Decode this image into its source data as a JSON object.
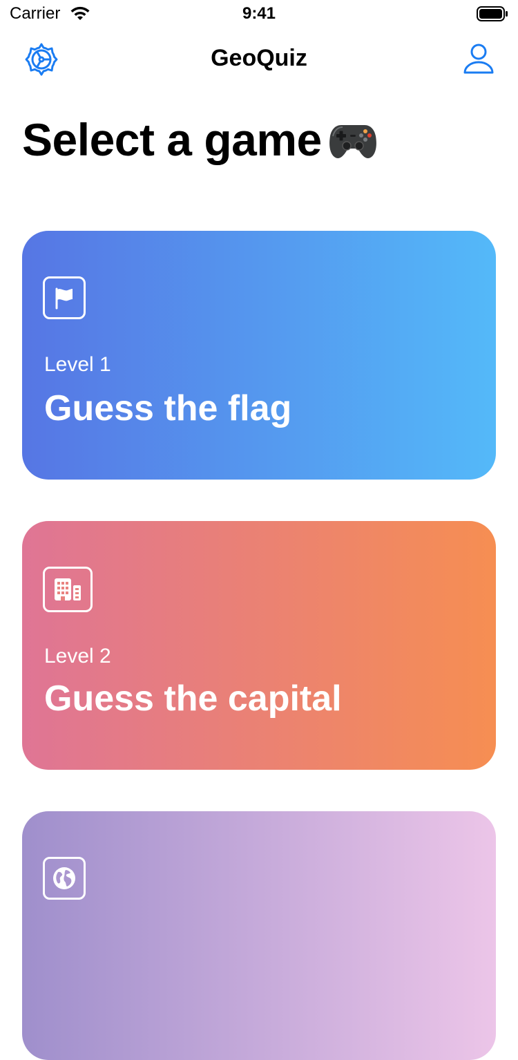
{
  "status_bar": {
    "carrier": "Carrier",
    "time": "9:41"
  },
  "nav": {
    "title": "GeoQuiz",
    "left_icon": "settings-icon",
    "right_icon": "profile-icon"
  },
  "page": {
    "title": "Select a game",
    "title_emoji_icon": "gamepad-icon"
  },
  "colors": {
    "accent": "#1a7cf2",
    "card_1_gradient": [
      "#5676e4",
      "#54b9f9"
    ],
    "card_2_gradient": [
      "#df7595",
      "#f68e52"
    ],
    "card_3_gradient": [
      "#9f8fcc",
      "#ecc5e8"
    ]
  },
  "cards": [
    {
      "level": "Level 1",
      "title": "Guess the flag",
      "icon": "flag-icon"
    },
    {
      "level": "Level 2",
      "title": "Guess the capital",
      "icon": "building-icon"
    },
    {
      "icon": "globe-icon"
    }
  ]
}
